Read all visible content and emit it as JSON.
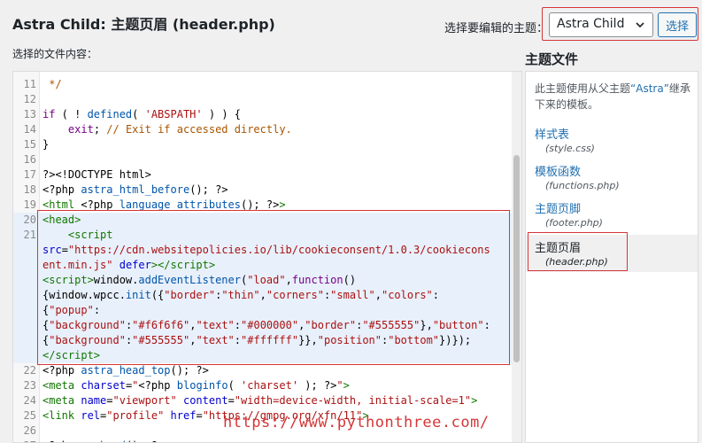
{
  "header": {
    "title": "Astra Child: 主题页眉 (header.php)",
    "select_theme_label": "选择要编辑的主题：",
    "selected_theme": "Astra Child",
    "select_button": "选择"
  },
  "editor": {
    "label": "选择的文件内容："
  },
  "sidebar": {
    "title": "主题文件",
    "description_prefix": "此主题使用从父主题",
    "description_quote": "“Astra”",
    "description_suffix": "继承下来的模板。",
    "files": [
      {
        "label": "样式表",
        "file": "(style.css)"
      },
      {
        "label": "模板函数",
        "file": "(functions.php)"
      },
      {
        "label": "主题页脚",
        "file": "(footer.php)"
      },
      {
        "label": "主题页眉",
        "file": "(header.php)",
        "active": true
      }
    ]
  },
  "watermark": "https://www.pythonthree.com/",
  "colors": {
    "accent": "#2271b1",
    "highlight_border": "#d63638",
    "highlight_bg": "#e8f0fb"
  }
}
